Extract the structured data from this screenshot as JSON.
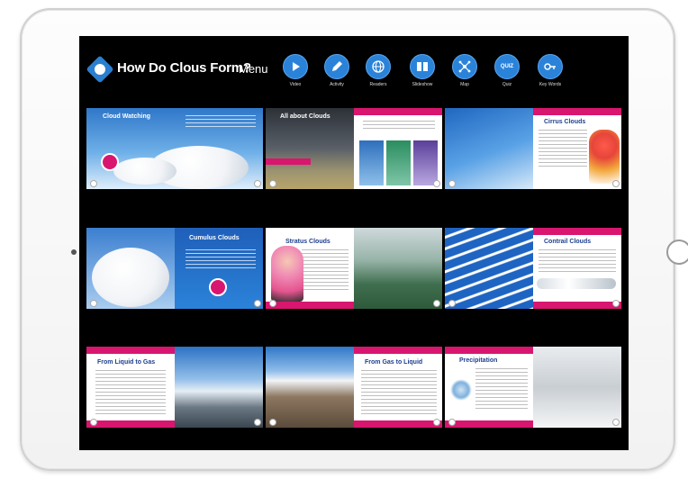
{
  "header": {
    "title": "How Do Clous Form?",
    "menu_label": "Menu",
    "nav": [
      {
        "label": "Video",
        "icon": "play-icon"
      },
      {
        "label": "Activity",
        "icon": "pencil-icon"
      },
      {
        "label": "Readers",
        "icon": "globe-icon"
      },
      {
        "label": "Slideshow",
        "icon": "slideshow-icon"
      },
      {
        "label": "Map",
        "icon": "map-icon"
      },
      {
        "label": "Quiz",
        "icon": "quiz-icon",
        "glyph": "QUIZ"
      },
      {
        "label": "Key Words",
        "icon": "key-icon"
      }
    ]
  },
  "slides": [
    {
      "title": "Cloud Watching"
    },
    {
      "title": "All about Clouds"
    },
    {
      "title": "Cirrus Clouds"
    },
    {
      "title": "Cumulus Clouds"
    },
    {
      "title": "Stratus Clouds"
    },
    {
      "title": "Contrail Clouds"
    },
    {
      "title": "From Liquid to Gas"
    },
    {
      "title": "From Gas to Liquid"
    },
    {
      "title": "Precipitation"
    }
  ],
  "colors": {
    "accent_blue": "#2b83d9",
    "accent_pink": "#d8166f",
    "title_blue": "#1d3f8f",
    "screen_bg": "#000000"
  }
}
